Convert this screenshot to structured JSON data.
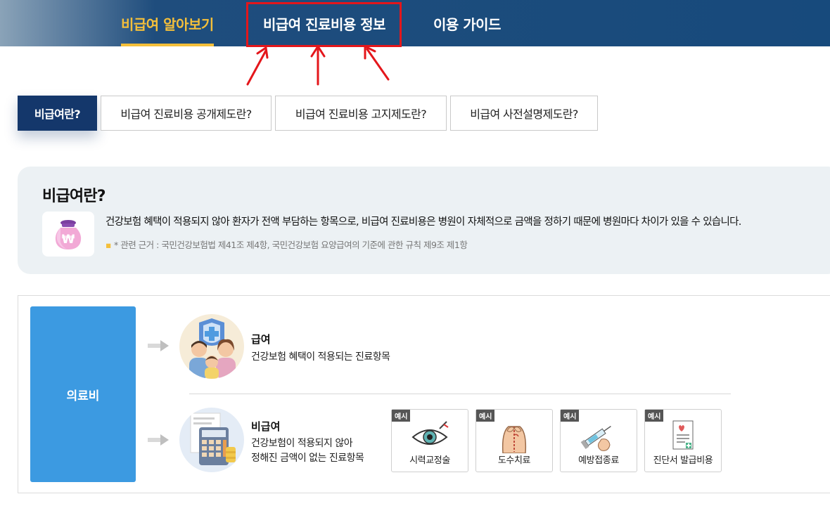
{
  "nav": {
    "items": [
      {
        "label": "비급여 알아보기"
      },
      {
        "label": "비급여 진료비용 정보"
      },
      {
        "label": "이용 가이드"
      }
    ]
  },
  "subtabs": [
    {
      "label": "비급여란?"
    },
    {
      "label": "비급여 진료비용 공개제도란?"
    },
    {
      "label": "비급여 진료비용 고지제도란?"
    },
    {
      "label": "비급여 사전설명제도란?"
    }
  ],
  "info": {
    "title": "비급여란?",
    "description": "건강보험 혜택이 적용되지 않아 환자가 전액 부담하는 항목으로, 비급여 진료비용은 병원이 자체적으로 금액을 정하기 때문에 병원마다 차이가 있을 수 있습니다.",
    "note": "* 관련 근거 : 국민건강보험법 제41조 제4항, 국민건강보험 요양급여의 기준에 관한 규칙 제9조 제1항"
  },
  "diagram": {
    "root_label": "의료비",
    "covered": {
      "title": "급여",
      "desc": "건강보험 혜택이 적용되는 진료항목"
    },
    "noncovered": {
      "title": "비급여",
      "desc_line1": "건강보험이 적용되지 않아",
      "desc_line2": "정해진 금액이 없는 진료항목"
    },
    "badge": "예시",
    "examples": [
      {
        "label": "시력교정술",
        "icon": "eye-icon"
      },
      {
        "label": "도수치료",
        "icon": "back-massage-icon"
      },
      {
        "label": "예방접종료",
        "icon": "syringe-icon"
      },
      {
        "label": "진단서 발급비용",
        "icon": "document-icon"
      }
    ]
  },
  "colors": {
    "nav_bg": "#174a7c",
    "accent": "#f4bf3a",
    "highlight": "#e4161b",
    "active_tab": "#14376b",
    "med_box": "#3c9ae1"
  }
}
